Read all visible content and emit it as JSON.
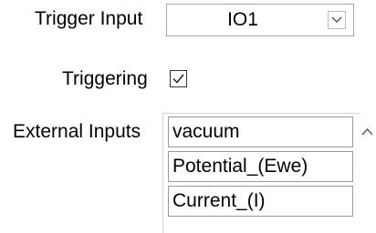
{
  "trigger_input": {
    "label": "Trigger Input",
    "selected_value": "IO1",
    "dropdown_icon": "chevron-down-icon"
  },
  "triggering": {
    "label": "Triggering",
    "checked": true,
    "check_icon": "checkmark-icon"
  },
  "external_inputs": {
    "label": "External Inputs",
    "items": [
      "vacuum",
      "Potential_(Ewe)",
      "Current_(I)"
    ],
    "scroll_icon": "chevron-up-icon"
  }
}
